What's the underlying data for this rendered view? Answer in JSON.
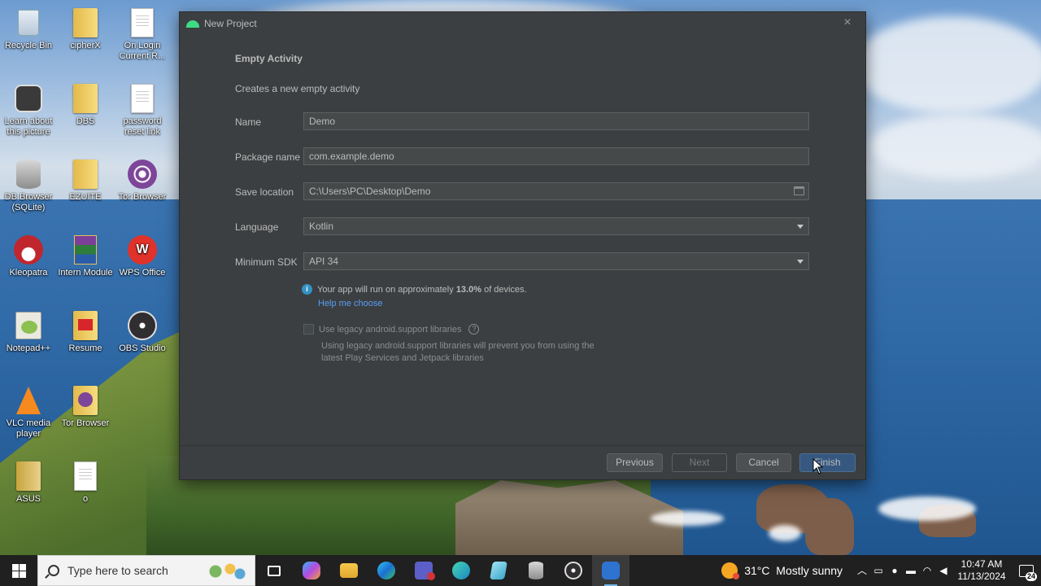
{
  "desktop": {
    "icons": [
      {
        "label": "Recycle Bin"
      },
      {
        "label": "cipherX"
      },
      {
        "label": "On Login Current R..."
      },
      {
        "label": "Learn about this picture"
      },
      {
        "label": "DBS"
      },
      {
        "label": "password reset link"
      },
      {
        "label": "DB Browser (SQLite)"
      },
      {
        "label": "EZUITE"
      },
      {
        "label": "Tor Browser"
      },
      {
        "label": "Kleopatra"
      },
      {
        "label": "Intern Module"
      },
      {
        "label": "WPS Office"
      },
      {
        "label": "Notepad++"
      },
      {
        "label": "Resume"
      },
      {
        "label": "OBS Studio"
      },
      {
        "label": "VLC media player"
      },
      {
        "label": "Tor Browser"
      },
      {
        "label": "ASUS"
      },
      {
        "label": "o"
      }
    ]
  },
  "dialog": {
    "title": "New Project",
    "heading": "Empty Activity",
    "subtitle": "Creates a new empty activity",
    "fields": {
      "name": {
        "label": "Name",
        "value": "Demo"
      },
      "package": {
        "label": "Package name",
        "value": "com.example.demo"
      },
      "save_location": {
        "label": "Save location",
        "value": "C:\\Users\\PC\\Desktop\\Demo"
      },
      "language": {
        "label": "Language",
        "value": "Kotlin"
      },
      "min_sdk": {
        "label": "Minimum SDK",
        "value": "API 34"
      }
    },
    "info": {
      "prefix": "Your app will run on approximately",
      "percent": "13.0%",
      "suffix": "of devices.",
      "help_link": "Help me choose"
    },
    "legacy": {
      "label": "Use legacy android.support libraries",
      "note": "Using legacy android.support libraries will prevent you from using the latest Play Services and Jetpack libraries"
    },
    "buttons": {
      "previous": "Previous",
      "next": "Next",
      "cancel": "Cancel",
      "finish": "Finish"
    }
  },
  "taskbar": {
    "search_placeholder": "Type here to search",
    "weather": {
      "temp": "31°C",
      "desc": "Mostly sunny"
    },
    "time": "10:47 AM",
    "date": "11/13/2024",
    "notification_count": "24"
  },
  "colors": {
    "dialog_bg": "#3c3f41",
    "field_bg": "#45494a",
    "primary_button": "#365880",
    "link": "#589df6",
    "info_icon": "#3592c4"
  }
}
